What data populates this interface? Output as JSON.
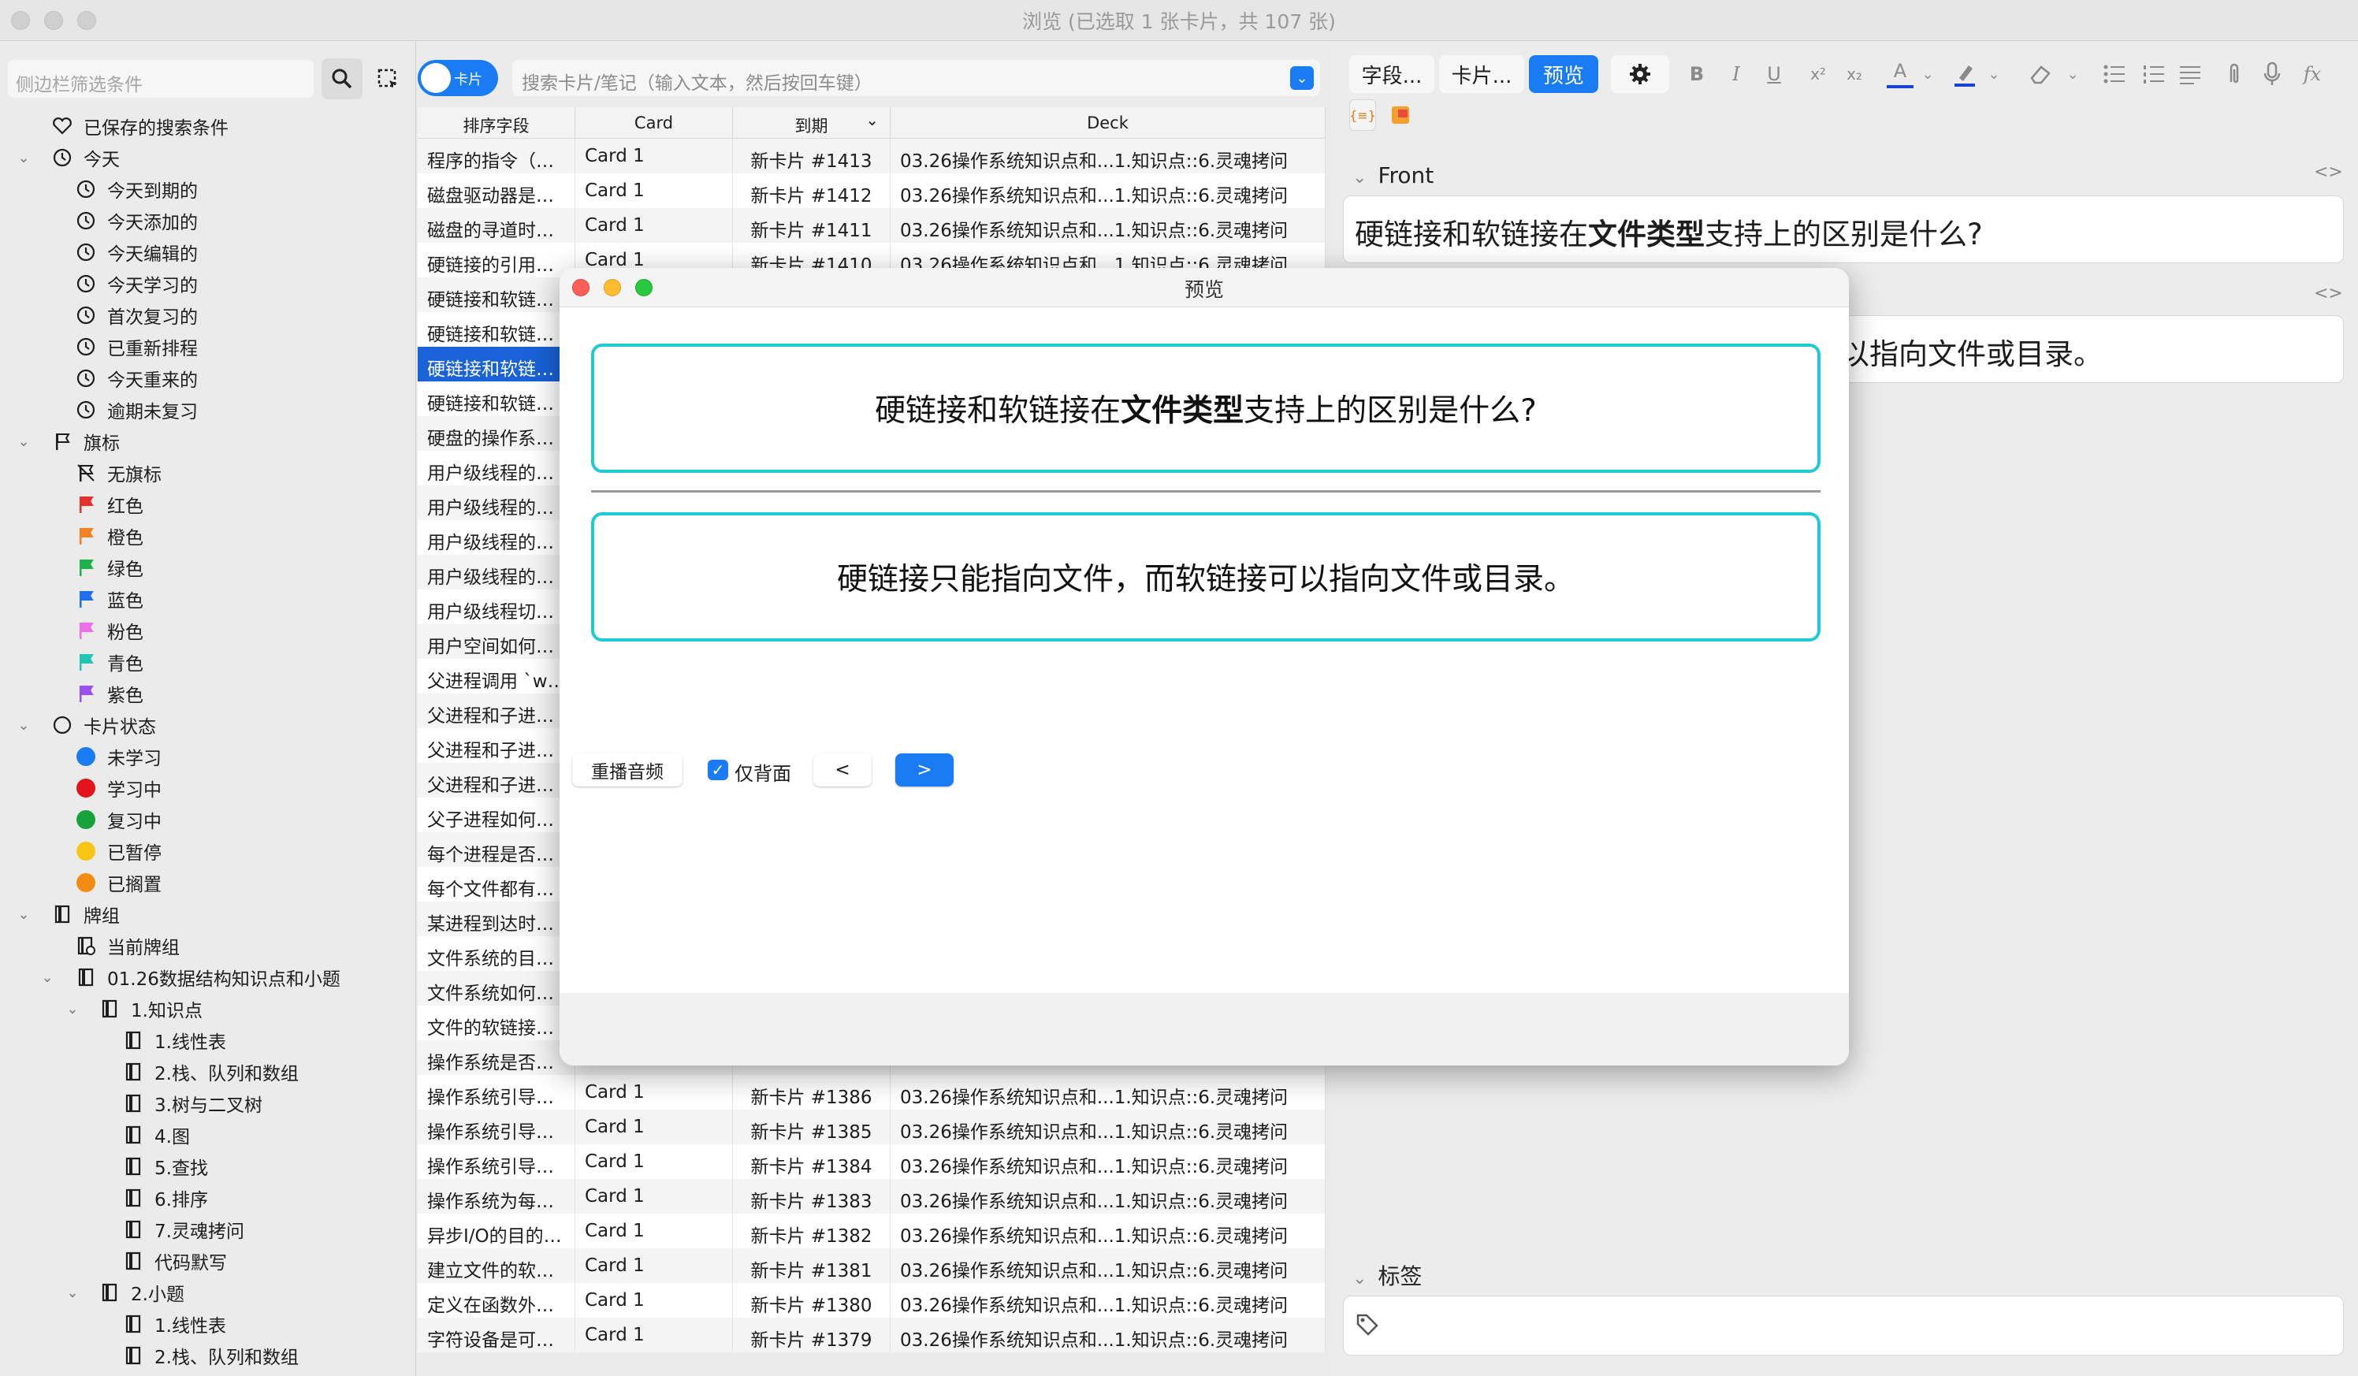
{
  "window": {
    "title": "浏览 (已选取 1 张卡片，共 107 张)"
  },
  "sidebar": {
    "filter_placeholder": "侧边栏筛选条件",
    "items": [
      {
        "label": "已保存的搜索条件",
        "level": 0,
        "icon": "heart-icon",
        "chev": ""
      },
      {
        "label": "今天",
        "level": 0,
        "icon": "clock-icon",
        "chev": "down"
      },
      {
        "label": "今天到期的",
        "level": 1,
        "icon": "clock-icon",
        "chev": ""
      },
      {
        "label": "今天添加的",
        "level": 1,
        "icon": "clock-icon",
        "chev": ""
      },
      {
        "label": "今天编辑的",
        "level": 1,
        "icon": "clock-icon",
        "chev": ""
      },
      {
        "label": "今天学习的",
        "level": 1,
        "icon": "clock-icon",
        "chev": ""
      },
      {
        "label": "首次复习的",
        "level": 1,
        "icon": "clock-icon",
        "chev": ""
      },
      {
        "label": "已重新排程",
        "level": 1,
        "icon": "clock-icon",
        "chev": ""
      },
      {
        "label": "今天重来的",
        "level": 1,
        "icon": "clock-icon",
        "chev": ""
      },
      {
        "label": "逾期未复习",
        "level": 1,
        "icon": "clock-icon",
        "chev": ""
      },
      {
        "label": "旗标",
        "level": 0,
        "icon": "flag-icon",
        "chev": "down"
      },
      {
        "label": "无旗标",
        "level": 1,
        "icon": "no-flag-icon",
        "chev": ""
      },
      {
        "label": "红色",
        "level": 1,
        "icon": "flag-icon",
        "color": "#e5312b",
        "chev": ""
      },
      {
        "label": "橙色",
        "level": 1,
        "icon": "flag-icon",
        "color": "#f58220",
        "chev": ""
      },
      {
        "label": "绿色",
        "level": 1,
        "icon": "flag-icon",
        "color": "#1fb24a",
        "chev": ""
      },
      {
        "label": "蓝色",
        "level": 1,
        "icon": "flag-icon",
        "color": "#1f6ff0",
        "chev": ""
      },
      {
        "label": "粉色",
        "level": 1,
        "icon": "flag-icon",
        "color": "#f06ee8",
        "chev": ""
      },
      {
        "label": "青色",
        "level": 1,
        "icon": "flag-icon",
        "color": "#20c5b5",
        "chev": ""
      },
      {
        "label": "紫色",
        "level": 1,
        "icon": "flag-icon",
        "color": "#9a4ff0",
        "chev": ""
      },
      {
        "label": "卡片状态",
        "level": 0,
        "icon": "circle-icon",
        "chev": "down"
      },
      {
        "label": "未学习",
        "level": 1,
        "icon": "dot-icon",
        "color": "#1a7cf5",
        "chev": ""
      },
      {
        "label": "学习中",
        "level": 1,
        "icon": "dot-icon",
        "color": "#e3141b",
        "chev": ""
      },
      {
        "label": "复习中",
        "level": 1,
        "icon": "dot-icon",
        "color": "#18a23c",
        "chev": ""
      },
      {
        "label": "已暂停",
        "level": 1,
        "icon": "dot-icon",
        "color": "#f7c515",
        "chev": ""
      },
      {
        "label": "已搁置",
        "level": 1,
        "icon": "dot-icon",
        "color": "#f28b11",
        "chev": ""
      },
      {
        "label": "牌组",
        "level": 0,
        "icon": "deck-icon",
        "chev": "down"
      },
      {
        "label": "当前牌组",
        "level": 1,
        "icon": "current-deck-icon",
        "chev": ""
      },
      {
        "label": "01.26数据结构知识点和小题",
        "level": 1,
        "icon": "deck-icon",
        "chev": "down"
      },
      {
        "label": "1.知识点",
        "level": 2,
        "icon": "deck-icon",
        "chev": "down"
      },
      {
        "label": "1.线性表",
        "level": 3,
        "icon": "deck-icon",
        "chev": ""
      },
      {
        "label": "2.栈、队列和数组",
        "level": 3,
        "icon": "deck-icon",
        "chev": ""
      },
      {
        "label": "3.树与二叉树",
        "level": 3,
        "icon": "deck-icon",
        "chev": ""
      },
      {
        "label": "4.图",
        "level": 3,
        "icon": "deck-icon",
        "chev": ""
      },
      {
        "label": "5.查找",
        "level": 3,
        "icon": "deck-icon",
        "chev": ""
      },
      {
        "label": "6.排序",
        "level": 3,
        "icon": "deck-icon",
        "chev": ""
      },
      {
        "label": "7.灵魂拷问",
        "level": 3,
        "icon": "deck-icon",
        "chev": ""
      },
      {
        "label": "代码默写",
        "level": 3,
        "icon": "deck-icon",
        "chev": ""
      },
      {
        "label": "2.小题",
        "level": 2,
        "icon": "deck-icon",
        "chev": "down"
      },
      {
        "label": "1.线性表",
        "level": 3,
        "icon": "deck-icon",
        "chev": ""
      },
      {
        "label": "2.栈、队列和数组",
        "level": 3,
        "icon": "deck-icon",
        "chev": ""
      }
    ]
  },
  "browser": {
    "mode_toggle": "卡片",
    "search_placeholder": "搜索卡片/笔记（输入文本，然后按回车键）",
    "columns": [
      "排序字段",
      "Card",
      "到期",
      "Deck"
    ],
    "rows": [
      [
        "程序的指令（…",
        "Card 1",
        "新卡片 #1413",
        "03.26操作系统知识点和...1.知识点::6.灵魂拷问"
      ],
      [
        "磁盘驱动器是…",
        "Card 1",
        "新卡片 #1412",
        "03.26操作系统知识点和...1.知识点::6.灵魂拷问"
      ],
      [
        "磁盘的寻道时…",
        "Card 1",
        "新卡片 #1411",
        "03.26操作系统知识点和...1.知识点::6.灵魂拷问"
      ],
      [
        "硬链接的引用…",
        "Card 1",
        "新卡片 #1410",
        "03.26操作系统知识点和...1.知识点::6.灵魂拷问"
      ],
      [
        "硬链接和软链…",
        "",
        "",
        ""
      ],
      [
        "硬链接和软链…",
        "",
        "",
        ""
      ],
      [
        "硬链接和软链…",
        "",
        "",
        ""
      ],
      [
        "硬链接和软链…",
        "",
        "",
        ""
      ],
      [
        "硬盘的操作系…",
        "",
        "",
        ""
      ],
      [
        "用户级线程的…",
        "",
        "",
        ""
      ],
      [
        "用户级线程的…",
        "",
        "",
        ""
      ],
      [
        "用户级线程的…",
        "",
        "",
        ""
      ],
      [
        "用户级线程的…",
        "",
        "",
        ""
      ],
      [
        "用户级线程切…",
        "",
        "",
        ""
      ],
      [
        "用户空间如何…",
        "",
        "",
        ""
      ],
      [
        "父进程调用 `w…",
        "",
        "",
        ""
      ],
      [
        "父进程和子进…",
        "",
        "",
        ""
      ],
      [
        "父进程和子进…",
        "",
        "",
        ""
      ],
      [
        "父进程和子进…",
        "",
        "",
        ""
      ],
      [
        "父子进程如何…",
        "",
        "",
        ""
      ],
      [
        "每个进程是否…",
        "",
        "",
        ""
      ],
      [
        "每个文件都有…",
        "",
        "",
        ""
      ],
      [
        "某进程到达时…",
        "",
        "",
        ""
      ],
      [
        "文件系统的目…",
        "",
        "",
        ""
      ],
      [
        "文件系统如何…",
        "",
        "",
        ""
      ],
      [
        "文件的软链接…",
        "",
        "",
        ""
      ],
      [
        "操作系统是否…",
        "",
        "",
        ""
      ],
      [
        "操作系统引导…",
        "Card 1",
        "新卡片 #1386",
        "03.26操作系统知识点和...1.知识点::6.灵魂拷问"
      ],
      [
        "操作系统引导…",
        "Card 1",
        "新卡片 #1385",
        "03.26操作系统知识点和...1.知识点::6.灵魂拷问"
      ],
      [
        "操作系统引导…",
        "Card 1",
        "新卡片 #1384",
        "03.26操作系统知识点和...1.知识点::6.灵魂拷问"
      ],
      [
        "操作系统为每…",
        "Card 1",
        "新卡片 #1383",
        "03.26操作系统知识点和...1.知识点::6.灵魂拷问"
      ],
      [
        "异步I/O的目的…",
        "Card 1",
        "新卡片 #1382",
        "03.26操作系统知识点和...1.知识点::6.灵魂拷问"
      ],
      [
        "建立文件的软…",
        "Card 1",
        "新卡片 #1381",
        "03.26操作系统知识点和...1.知识点::6.灵魂拷问"
      ],
      [
        "定义在函数外…",
        "Card 1",
        "新卡片 #1380",
        "03.26操作系统知识点和...1.知识点::6.灵魂拷问"
      ],
      [
        "字符设备是可…",
        "Card 1",
        "新卡片 #1379",
        "03.26操作系统知识点和...1.知识点::6.灵魂拷问"
      ]
    ],
    "selected_row": 6
  },
  "editor": {
    "fields_button": "字段...",
    "cards_button": "卡片...",
    "preview_button": "预览",
    "front_label": "Front",
    "front_prefix": "硬链接和软链接在",
    "front_bold": "文件类型",
    "front_suffix": "支持上的区别是什么?",
    "back_partial": "以指向文件或目录。",
    "tags_label": "标签",
    "format": {
      "bold": "B",
      "italic": "I",
      "underline": "U",
      "sup": "x²",
      "sub": "x₂",
      "color": "A",
      "fx": "fx"
    }
  },
  "preview": {
    "title": "预览",
    "front_prefix": "硬链接和软链接在",
    "front_bold": "文件类型",
    "front_suffix": "支持上的区别是什么?",
    "back": "硬链接只能指向文件，而软链接可以指向文件或目录。",
    "replay_audio": "重播音频",
    "back_only_label": "仅背面",
    "prev": "<",
    "next": ">"
  },
  "colors": {
    "accent": "#1a7cf5",
    "selection": "#1962d8",
    "card_border": "#1ecbd4"
  }
}
